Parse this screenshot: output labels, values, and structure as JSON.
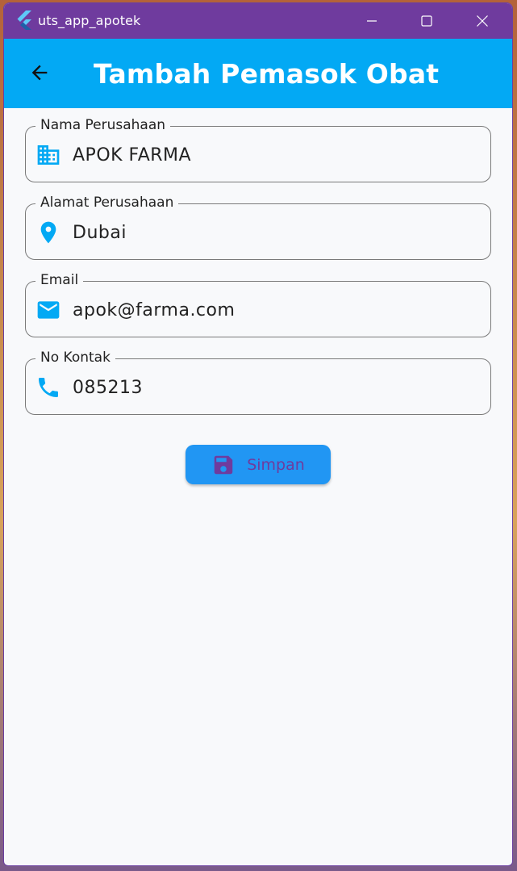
{
  "window": {
    "title": "uts_app_apotek",
    "accent_color": "#6f3b9e"
  },
  "appbar": {
    "title": "Tambah Pemasok Obat",
    "color": "#03a9f4"
  },
  "form": {
    "company_name": {
      "label": "Nama Perusahaan",
      "value": "APOK FARMA",
      "icon": "building-icon"
    },
    "company_address": {
      "label": "Alamat Perusahaan",
      "value": "Dubai",
      "icon": "location-pin-icon"
    },
    "email": {
      "label": "Email",
      "value": "apok@farma.com",
      "icon": "mail-icon"
    },
    "contact": {
      "label": "No Kontak",
      "value": "085213",
      "icon": "phone-icon"
    }
  },
  "save_button": {
    "label": "Simpan",
    "icon": "save-icon"
  }
}
